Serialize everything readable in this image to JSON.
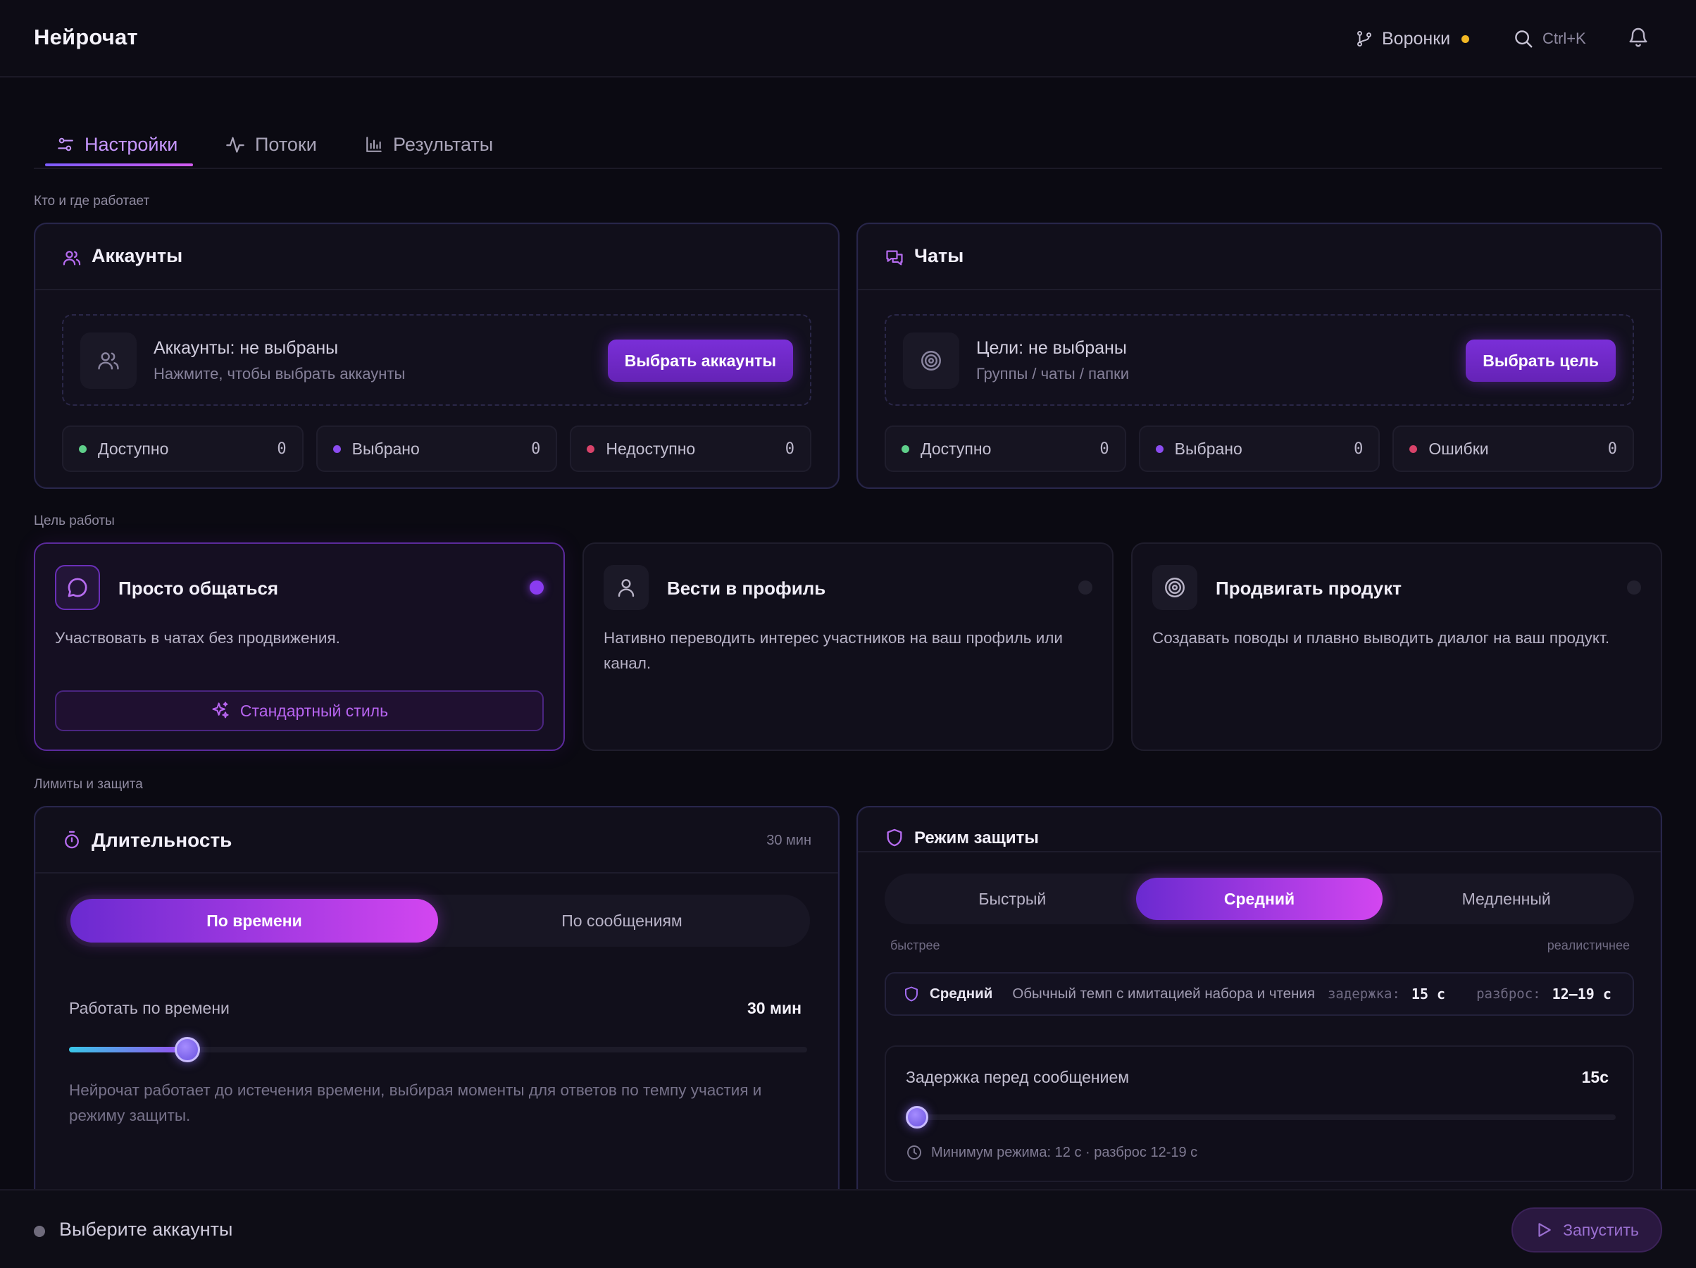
{
  "app": {
    "title": "Нейрочат"
  },
  "header": {
    "funnels_label": "Воронки",
    "search_shortcut": "Ctrl+K",
    "colors": {
      "funnel_dot": "#f2b824"
    }
  },
  "tabs": [
    {
      "label": "Настройки",
      "icon": "sliders-icon",
      "active": true
    },
    {
      "label": "Потоки",
      "icon": "activity-icon",
      "active": false
    },
    {
      "label": "Результаты",
      "icon": "bar-chart-icon",
      "active": false
    }
  ],
  "sections": {
    "who": "Кто и где работает",
    "goal": "Цель работы",
    "limits": "Лимиты и защита"
  },
  "accounts": {
    "title": "Аккаунты",
    "picker_title": "Аккаунты: не выбраны",
    "picker_sub": "Нажмите, чтобы выбрать аккаунты",
    "button": "Выбрать аккаунты",
    "stats": [
      {
        "label": "Доступно",
        "value": "0",
        "color": "#5fcf8a"
      },
      {
        "label": "Выбрано",
        "value": "0",
        "color": "#8b4cf0"
      },
      {
        "label": "Недоступно",
        "value": "0",
        "color": "#d9436a"
      }
    ]
  },
  "chats": {
    "title": "Чаты",
    "picker_title": "Цели: не выбраны",
    "picker_sub": "Группы / чаты / папки",
    "button": "Выбрать цель",
    "stats": [
      {
        "label": "Доступно",
        "value": "0",
        "color": "#5fcf8a"
      },
      {
        "label": "Выбрано",
        "value": "0",
        "color": "#8b4cf0"
      },
      {
        "label": "Ошибки",
        "value": "0",
        "color": "#d9436a"
      }
    ]
  },
  "goals": [
    {
      "title": "Просто общаться",
      "desc": "Участвовать в чатах без продвижения.",
      "selected": true,
      "style_button": "Стандартный стиль",
      "icon": "chat-bubble-icon"
    },
    {
      "title": "Вести в профиль",
      "desc": "Нативно переводить интерес участников на ваш профиль или канал.",
      "selected": false,
      "icon": "user-icon"
    },
    {
      "title": "Продвигать продукт",
      "desc": "Создавать поводы и плавно выводить диалог на ваш продукт.",
      "selected": false,
      "icon": "target-icon"
    }
  ],
  "duration": {
    "title": "Длительность",
    "badge": "30 мин",
    "modes": [
      "По времени",
      "По сообщениям"
    ],
    "active_mode": 0,
    "work_label": "Работать по времени",
    "work_value": "30 мин",
    "slider_fraction": 0.16,
    "description": "Нейрочат работает до истечения времени, выбирая моменты для ответов по темпу участия и режиму защиты."
  },
  "protection": {
    "title": "Режим защиты",
    "modes": [
      "Быстрый",
      "Средний",
      "Медленный"
    ],
    "active_mode": 1,
    "hint_left": "быстрее",
    "hint_right": "реалистичнее",
    "info_name": "Средний",
    "info_desc": "Обычный темп с имитацией набора и чтения",
    "delay_key": "задержка:",
    "delay_val": "15 с",
    "spread_key": "разброс:",
    "spread_val": "12–19 с",
    "delay_label": "Задержка перед сообщением",
    "delay_value": "15c",
    "delay_slider_fraction": 0.0,
    "delay_note": "Минимум режима: 12 с · разброс 12-19 с"
  },
  "footer": {
    "status": "Выберите аккаунты",
    "run_button": "Запустить"
  },
  "colors": {
    "accent": "#8b4cf0",
    "accent_pink": "#d346f0",
    "background": "#0b0a12"
  }
}
